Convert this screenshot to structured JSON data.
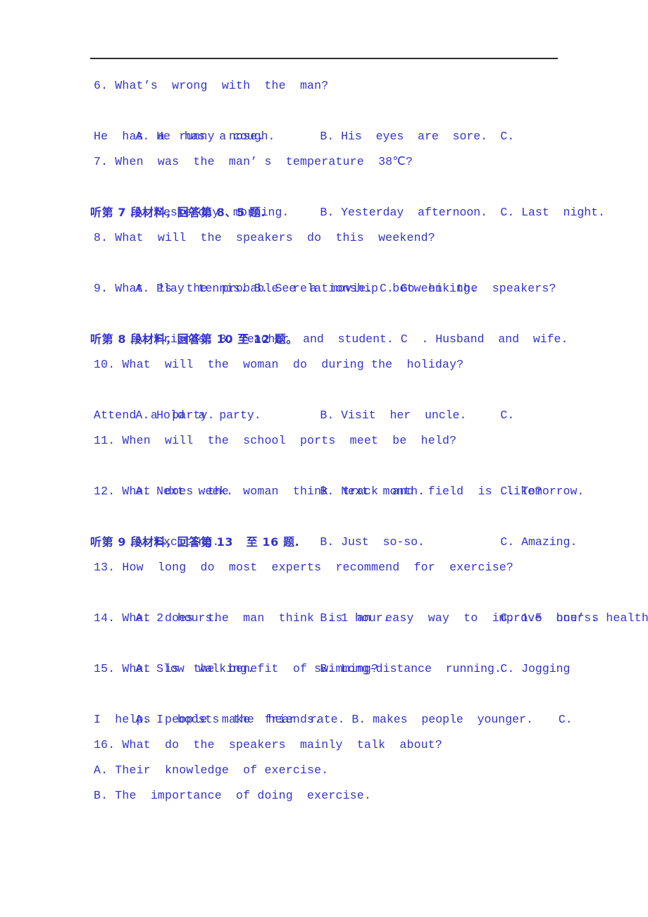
{
  "page": {
    "language": "mixed-en-zh",
    "text_color": "#3333CC",
    "rule_color": "#2D2D2D",
    "background": "#FFFFFF"
  },
  "lines": [
    {
      "id": "q6-stem",
      "kind": "question",
      "text": "6. What’s  wrong  with  the  man?"
    },
    {
      "id": "q6-options",
      "kind": "options",
      "a": "A. He  has  a cough.",
      "b": "B. His  eyes  are  sore.",
      "c": "C."
    },
    {
      "id": "q6-options-wrap",
      "kind": "question",
      "text": "He  has  a  runny  nose."
    },
    {
      "id": "q7-stem",
      "kind": "question",
      "text": "7. When  was  the  man’ s  temperature  38℃?"
    },
    {
      "id": "q7-options",
      "kind": "options",
      "a": "A. Yesterday  morning.",
      "b": "B. Yesterday  afternoon.",
      "c": "C. Last  night."
    },
    {
      "id": "cn-heading-7",
      "kind": "section-heading-cn",
      "text": "听第 7 段材料，回答第 8、5 题."
    },
    {
      "id": "q8-stem",
      "kind": "question",
      "text": "8. What  will  the  speakers  do  this  weekend?"
    },
    {
      "id": "q8-options",
      "kind": "options-flow",
      "a": "A. Play  tennis. ",
      "b": "B. See  a  movie. ",
      "c": "C. Go  hiking."
    },
    {
      "id": "q9-stem",
      "kind": "question",
      "text": "9. What  is  the  probable  relationship  between  the  speakers?"
    },
    {
      "id": "q9-options",
      "kind": "options-flow",
      "a": "A. Friends. ",
      "b": "B. Teacher  and  student. ",
      "c": "C  . Husband  and  wife."
    },
    {
      "id": "cn-heading-8",
      "kind": "section-heading-cn",
      "text": "听第 8 段材料，回答第 10 至 12 题。"
    },
    {
      "id": "q10-stem",
      "kind": "question",
      "text": "10. What  will  the  woman  do  during the  holiday?"
    },
    {
      "id": "q10-options",
      "kind": "options",
      "a": "A. Hold  a  party.",
      "b": "B. Visit  her  uncle.",
      "c": "C."
    },
    {
      "id": "q10-options-wrap",
      "kind": "question",
      "text": "Attend  a  party."
    },
    {
      "id": "q11-stem",
      "kind": "question",
      "text": "11. When  will  the  school  ports  meet  be  held?"
    },
    {
      "id": "q11-options",
      "kind": "options",
      "a": "A. Next  week.",
      "b": "B. Next  month.",
      "c": "C. Tomorrow."
    },
    {
      "id": "q12-stem",
      "kind": "question",
      "text": "12. What  does  the  woman  think  track  and  field  is  like?"
    },
    {
      "id": "q12-options",
      "kind": "options",
      "a": "A. Exciting.",
      "b": "B. Just  so-so.",
      "c": "C. Amazing."
    },
    {
      "id": "cn-heading-9",
      "kind": "section-heading-cn",
      "text": "听第 9 段材料，回答第 13   至 16 题."
    },
    {
      "id": "q13-stem",
      "kind": "question",
      "text": "13. How  long  do  most  experts  recommend  for  exercise?"
    },
    {
      "id": "q13-options",
      "kind": "options",
      "a": "A. 2  hours.",
      "b": "B. 1 hour.",
      "c": "C. 1.5  hours."
    },
    {
      "id": "q14-stem",
      "kind": "question",
      "text": "14. What  does  the  man  think  is  an  easy  way  to  improve  one’ s health?"
    },
    {
      "id": "q14-options",
      "kind": "options",
      "a": "A. Slow  walking.",
      "b": "B. Long-distance  running.",
      "c": "C. Jogging"
    },
    {
      "id": "q15-stem",
      "kind": "question",
      "text": "15. What  is  the  benefit  of swimming?"
    },
    {
      "id": "q15-options",
      "kind": "options",
      "a": "A. I  boosts  the  hear  rate. ",
      "b": "B. makes  people  younger.",
      "c": "C."
    },
    {
      "id": "q15-options-wrap",
      "kind": "question",
      "text": "I  helps  people  make  friends."
    },
    {
      "id": "q16-stem",
      "kind": "question",
      "text": "16. What  do  the  speakers  mainly  talk  about?"
    },
    {
      "id": "q16-option-a",
      "kind": "question",
      "text": "A. Their  knowledge  of exercise."
    },
    {
      "id": "q16-option-b",
      "kind": "question",
      "text": "B. The  importance  of doing  exercise."
    }
  ]
}
